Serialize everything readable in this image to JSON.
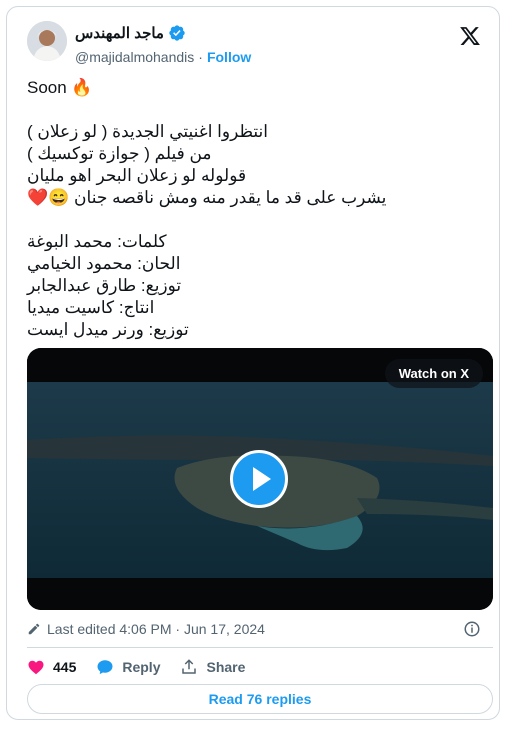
{
  "author": {
    "display_name": "ماجد المهندس",
    "handle": "@majidalmohandis",
    "separator": "·",
    "follow_label": "Follow"
  },
  "tweet": {
    "lines": [
      "Soon 🔥",
      "",
      "انتظروا اغنيتي الجديدة ( لو زعلان )",
      "من فيلم ( جوازة توكسيك )",
      "قولوله لو زعلان البحر اهو مليان",
      "يشرب على قد ما يقدر منه ومش ناقصه جنان 😄❤️",
      "",
      "كلمات: محمد البوغة",
      "الحان: محمود الخيامي",
      "توزيع: طارق عبدالجابر",
      "انتاج: كاسيت ميديا",
      "توزيع: ورنر ميدل ايست"
    ]
  },
  "media": {
    "watch_label": "Watch on X"
  },
  "meta": {
    "edited": "Last edited 4:06 PM · Jun 17, 2024"
  },
  "actions": {
    "likes": "445",
    "reply_label": "Reply",
    "share_label": "Share"
  },
  "replies_label": "Read 76 replies",
  "colors": {
    "accent": "#1d9bf0",
    "like": "#f91880",
    "text": "#0f1419",
    "secondary": "#536471"
  },
  "icons": [
    "verified-badge-icon",
    "x-logo-icon",
    "play-icon",
    "edit-pencil-icon",
    "info-icon",
    "heart-icon",
    "reply-bubble-icon",
    "share-icon"
  ]
}
